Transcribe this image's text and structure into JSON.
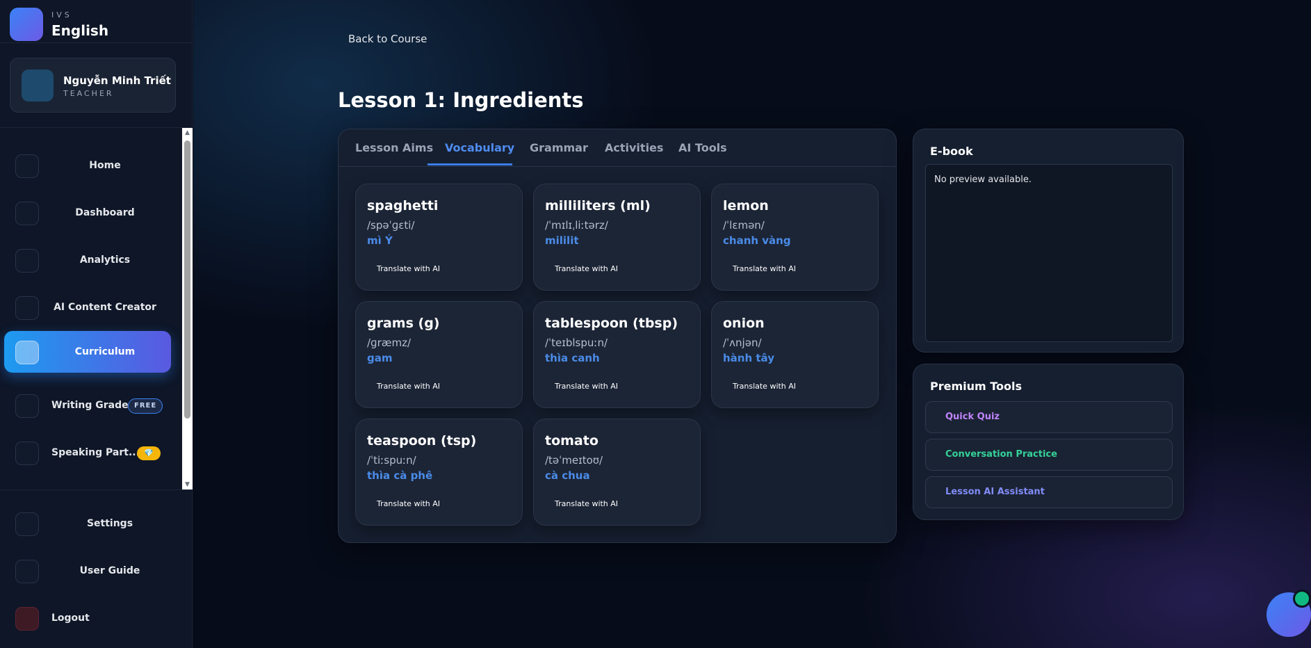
{
  "brand": {
    "small": "IVS",
    "big": "English"
  },
  "user": {
    "name": "Nguyễn Minh Triết",
    "role": "TEACHER"
  },
  "sidebar": {
    "items": [
      {
        "label": "Home"
      },
      {
        "label": "Dashboard"
      },
      {
        "label": "Analytics"
      },
      {
        "label": "AI Content Creator"
      },
      {
        "label": "Curriculum",
        "active": true
      },
      {
        "label": "Writing Grader",
        "badge": "FREE"
      },
      {
        "label": "Speaking Part...",
        "badge_icon": "💎"
      }
    ],
    "bottom": [
      {
        "label": "Settings"
      },
      {
        "label": "User Guide"
      },
      {
        "label": "Logout"
      }
    ]
  },
  "main": {
    "back_label": "Back to Course",
    "title": "Lesson 1: Ingredients",
    "tabs": [
      {
        "label": "Lesson Aims"
      },
      {
        "label": "Vocabulary",
        "active": true
      },
      {
        "label": "Grammar"
      },
      {
        "label": "Activities"
      },
      {
        "label": "AI Tools"
      }
    ],
    "translate_label": "Translate with AI",
    "vocab": [
      {
        "word": "spaghetti",
        "ipa": "/spəˈɡɛti/",
        "meaning": "mì Ý"
      },
      {
        "word": "milliliters (ml)",
        "ipa": "/ˈmɪlɪˌliːtərz/",
        "meaning": "mililit"
      },
      {
        "word": "lemon",
        "ipa": "/ˈlɛmən/",
        "meaning": "chanh vàng"
      },
      {
        "word": "grams (g)",
        "ipa": "/ɡræmz/",
        "meaning": "gam"
      },
      {
        "word": "tablespoon (tbsp)",
        "ipa": "/ˈteɪblspuːn/",
        "meaning": "thìa canh"
      },
      {
        "word": "onion",
        "ipa": "/ˈʌnjən/",
        "meaning": "hành tây"
      },
      {
        "word": "teaspoon (tsp)",
        "ipa": "/ˈtiːspuːn/",
        "meaning": "thìa cà phê"
      },
      {
        "word": "tomato",
        "ipa": "/təˈmeɪtoʊ/",
        "meaning": "cà chua"
      }
    ]
  },
  "ebook": {
    "title": "E-book",
    "preview_text": "No preview available."
  },
  "premium_tools": {
    "title": "Premium Tools",
    "items": [
      {
        "label": "Quick Quiz",
        "color": "#c084fc"
      },
      {
        "label": "Conversation Practice",
        "color": "#34d399"
      },
      {
        "label": "Lesson AI Assistant",
        "color": "#818cf8"
      }
    ]
  },
  "colors": {
    "accent": "#3b7de8",
    "active_nav_start": "#1d9bf0",
    "active_nav_end": "#5a59e0"
  }
}
